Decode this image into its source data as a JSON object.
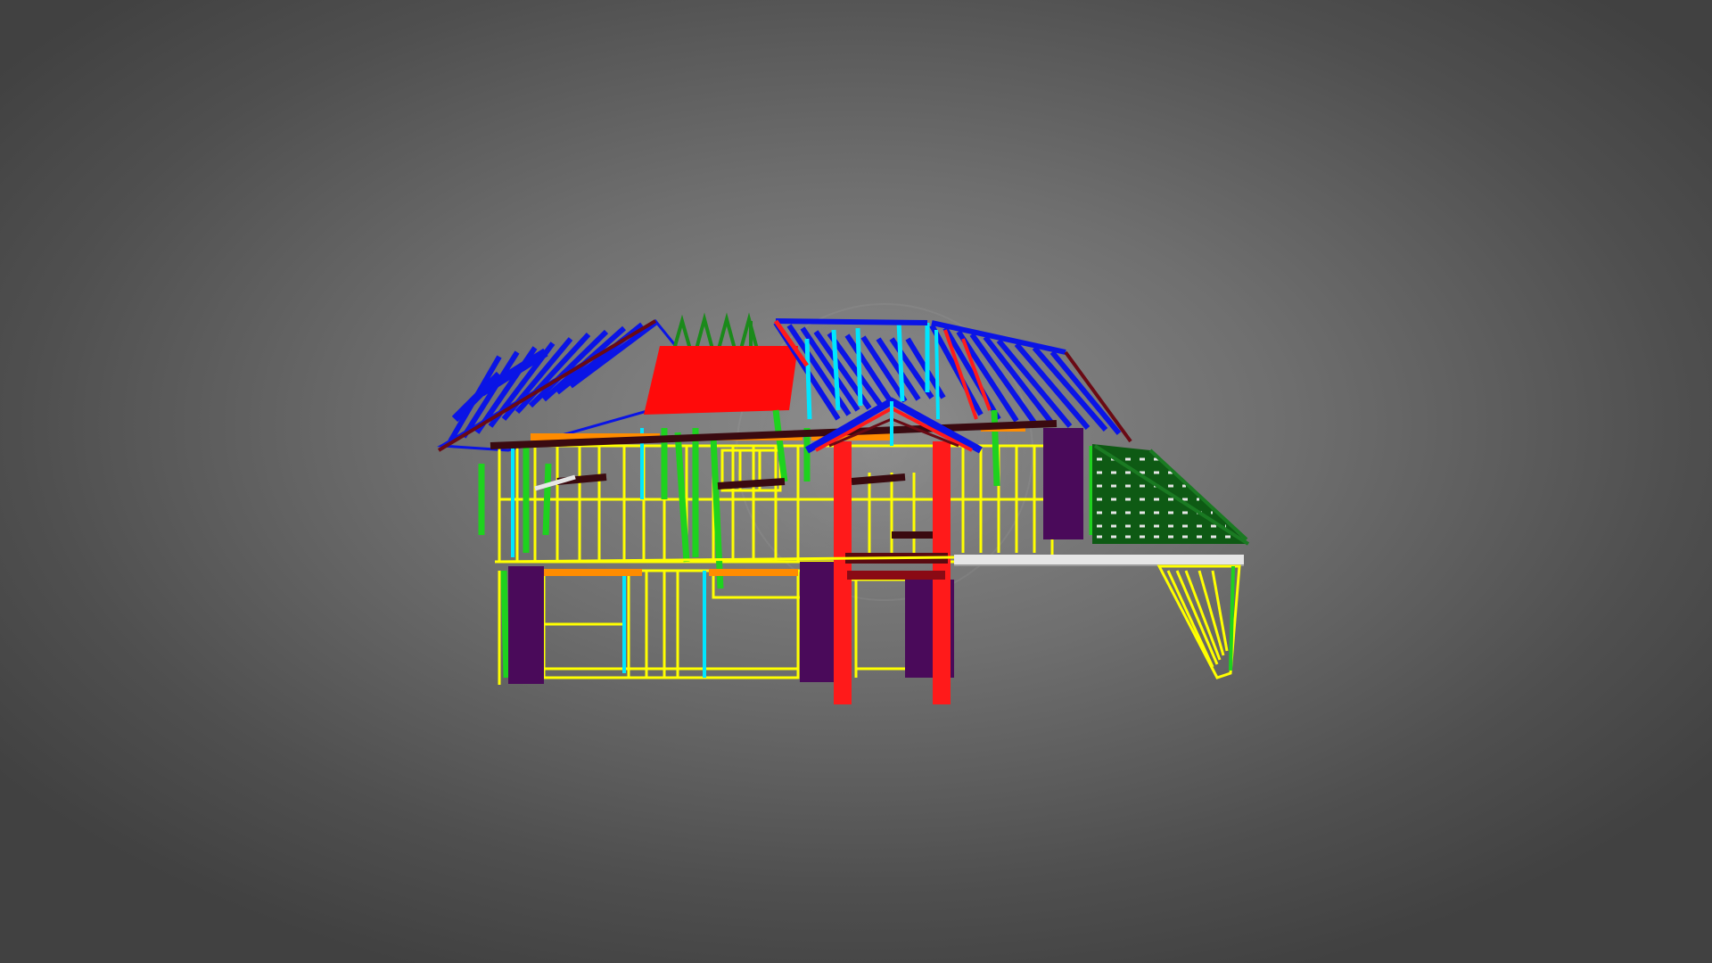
{
  "viewer": {
    "background_center": "#8b8b8b",
    "background_edge": "#414141",
    "mode": "3d-model-viewer"
  },
  "model": {
    "subject": "house-frame-wireframe",
    "colors": {
      "roof_rafters": "#0a14e6",
      "roof_panel": "#ff0000",
      "wall_studs": "#ffff00",
      "green_members": "#1ed21e",
      "cyan_members": "#00ffff",
      "orange_members": "#ff8c00",
      "purple_panels": "#4a0a5a",
      "red_posts": "#ff1a1a",
      "pergola_rafters": "#0e5a14",
      "dark_beams": "#6a0a14",
      "white_beam": "#e6e6e6"
    }
  }
}
